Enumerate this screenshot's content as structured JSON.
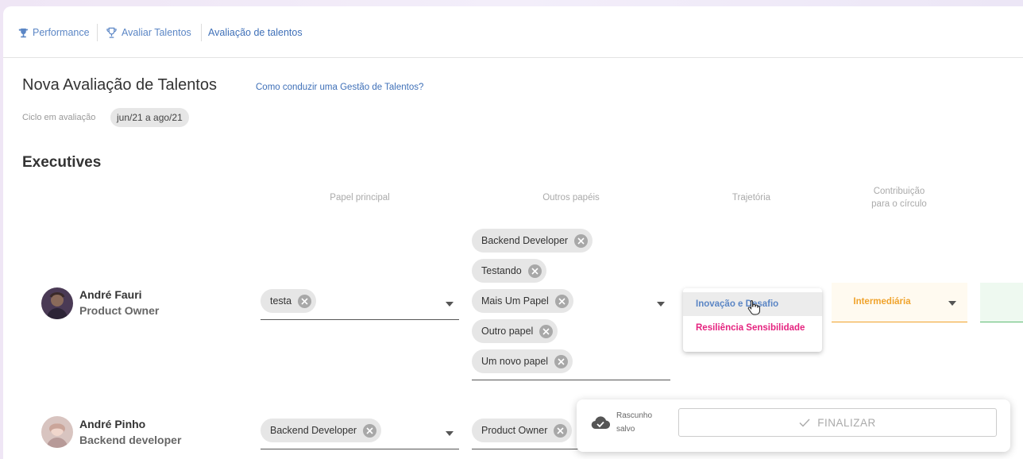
{
  "breadcrumb": [
    {
      "label": "Performance"
    },
    {
      "label": "Avaliar Talentos"
    },
    {
      "label": "Avaliação de talentos"
    }
  ],
  "page": {
    "title": "Nova Avaliação de Talentos",
    "help_link": "Como conduzir uma Gestão de Talentos?",
    "cycle_label": "Ciclo em avaliação",
    "cycle_value": "jun/21 a ago/21",
    "section_title": "Executives"
  },
  "columns": {
    "main_role": "Papel principal",
    "other_roles": "Outros papéis",
    "trajectory": "Trajetória",
    "contribution_line1": "Contribuição",
    "contribution_line2": "para o círculo"
  },
  "people": [
    {
      "name": "André Fauri",
      "role": "Product Owner",
      "main_role": "testa",
      "other_roles": [
        "Backend Developer",
        "Testando",
        "Mais Um Papel",
        "Outro papel",
        "Um novo papel"
      ],
      "contribution": "Intermediária"
    },
    {
      "name": "André Pinho",
      "role": "Backend developer",
      "main_role": "Backend Developer",
      "other_roles": [
        "Product Owner"
      ]
    }
  ],
  "trajectory_dropdown": {
    "options": [
      "Inovação e Desafio",
      "Resiliência Sensibilidade"
    ],
    "highlighted": "Inovação e Desafio"
  },
  "save_panel": {
    "status_line1": "Rascunho",
    "status_line2": "salvo",
    "finalize_label": "FINALIZAR"
  },
  "colors": {
    "link": "#3f70b8",
    "pink": "#e5237f",
    "orange": "#f0a32c",
    "green": "#5cba72"
  }
}
